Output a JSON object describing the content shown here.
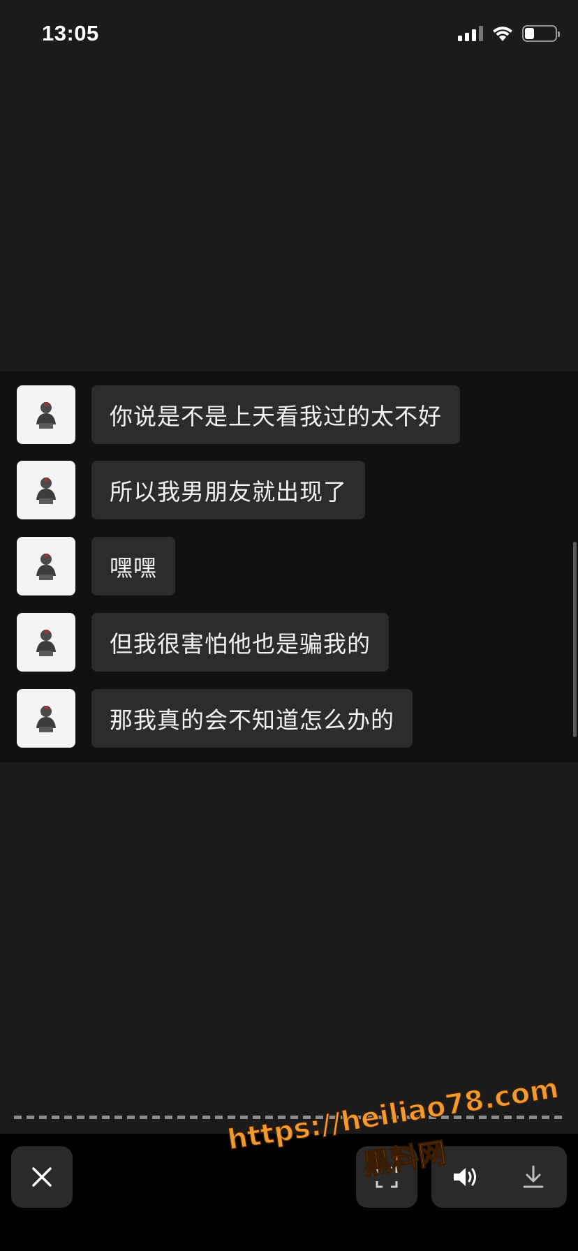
{
  "status_bar": {
    "time": "13:05",
    "icons": [
      "cellular-signal-icon",
      "wifi-icon",
      "battery-icon"
    ],
    "battery_level": 0.3
  },
  "chat": {
    "messages": [
      {
        "text": "你说是不是上天看我过的太不好",
        "avatar": "user-avatar"
      },
      {
        "text": "所以我男朋友就出现了",
        "avatar": "user-avatar"
      },
      {
        "text": "嘿嘿",
        "avatar": "user-avatar"
      },
      {
        "text": "但我很害怕他也是骗我的",
        "avatar": "user-avatar"
      },
      {
        "text": "那我真的会不知道怎么办的",
        "avatar": "user-avatar"
      }
    ]
  },
  "toolbar": {
    "close_icon": "close-icon",
    "scan_icon": "scan-icon",
    "sound_icon": "speaker-icon",
    "download_icon": "download-icon"
  },
  "watermark": {
    "url": "https://heiliao78.com",
    "name": "黑料网"
  },
  "colors": {
    "background": "#1b1b1b",
    "chat_panel": "#111111",
    "bubble": "#2c2c2c",
    "bottom_bar": "#000000",
    "button": "#2a2a2a",
    "watermark": "#f29a2e"
  }
}
